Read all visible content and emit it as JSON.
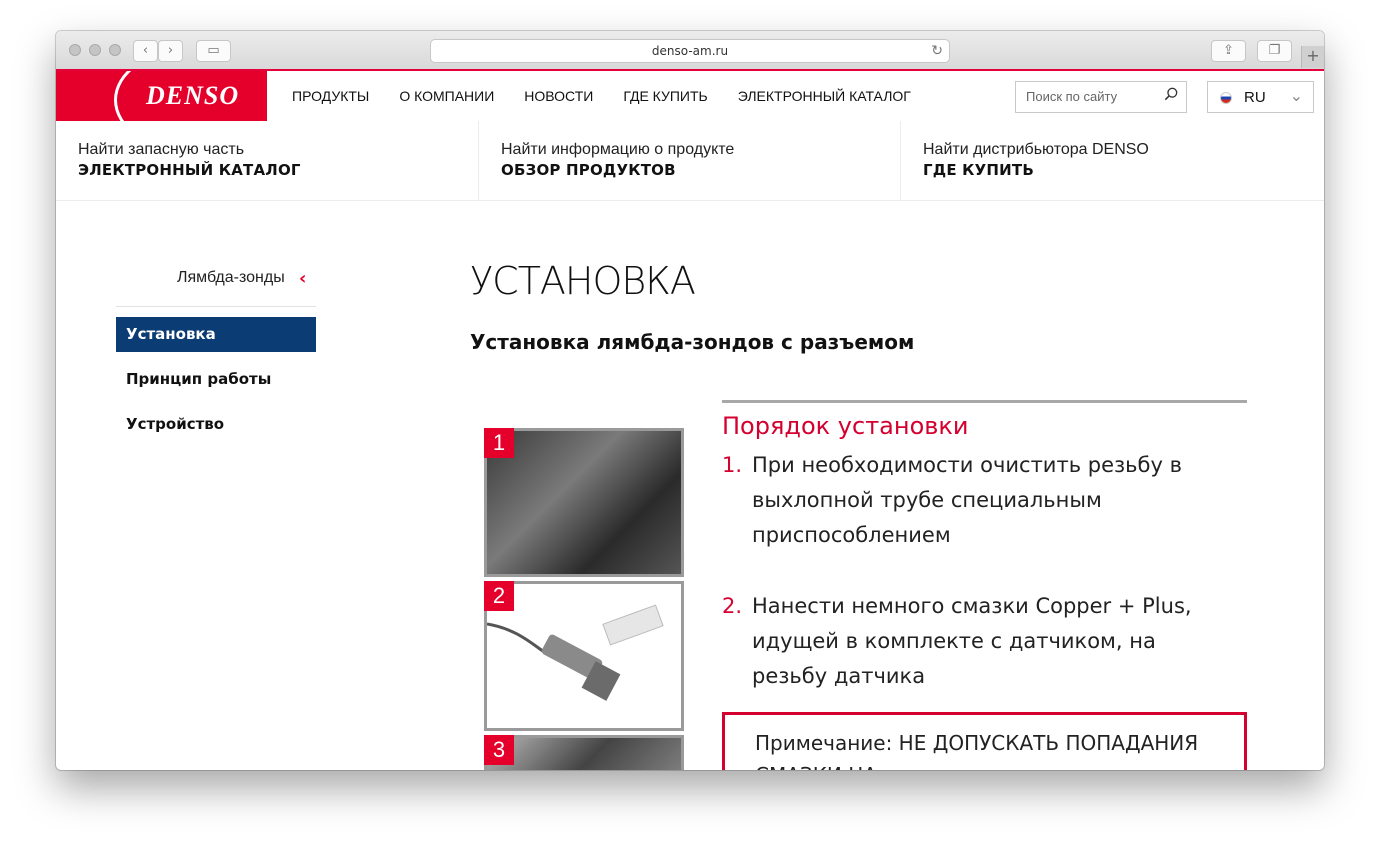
{
  "browser": {
    "url": "denso-am.ru"
  },
  "header": {
    "brand": "DENSO",
    "nav": [
      "ПРОДУКТЫ",
      "О КОМПАНИИ",
      "НОВОСТИ",
      "ГДЕ КУПИТЬ",
      "ЭЛЕКТРОННЫЙ КАТАЛОГ"
    ],
    "search_placeholder": "Поиск по сайту",
    "language": "RU"
  },
  "quick_links": [
    {
      "sub": "Найти запасную часть",
      "main": "ЭЛЕКТРОННЫЙ КАТАЛОГ"
    },
    {
      "sub": "Найти информацию о продукте",
      "main": "ОБЗОР ПРОДУКТОВ"
    },
    {
      "sub": "Найти дистрибьютора DENSO",
      "main": "ГДЕ КУПИТЬ"
    }
  ],
  "sidebar": {
    "parent": "Лямбда-зонды",
    "items": [
      "Установка",
      "Принцип работы",
      "Устройство"
    ]
  },
  "main": {
    "title": "УСТАНОВКА",
    "subtitle": "Установка лямбда-зондов с разъемом",
    "figure": {
      "photo_numbers": [
        "1",
        "2",
        "3"
      ],
      "heading": "Порядок установки",
      "steps": [
        {
          "num": "1.",
          "text": "При необходимости очистить резьбу в выхлопной трубе специальным приспособлением"
        },
        {
          "num": "2.",
          "text": "Нанести немного смазки Copper + Plus, идущей в комплекте с датчиком, на резьбу датчика"
        }
      ],
      "note": "Примечание: НЕ ДОПУСКАТЬ ПОПАДАНИЯ СМАЗКИ НА"
    }
  }
}
